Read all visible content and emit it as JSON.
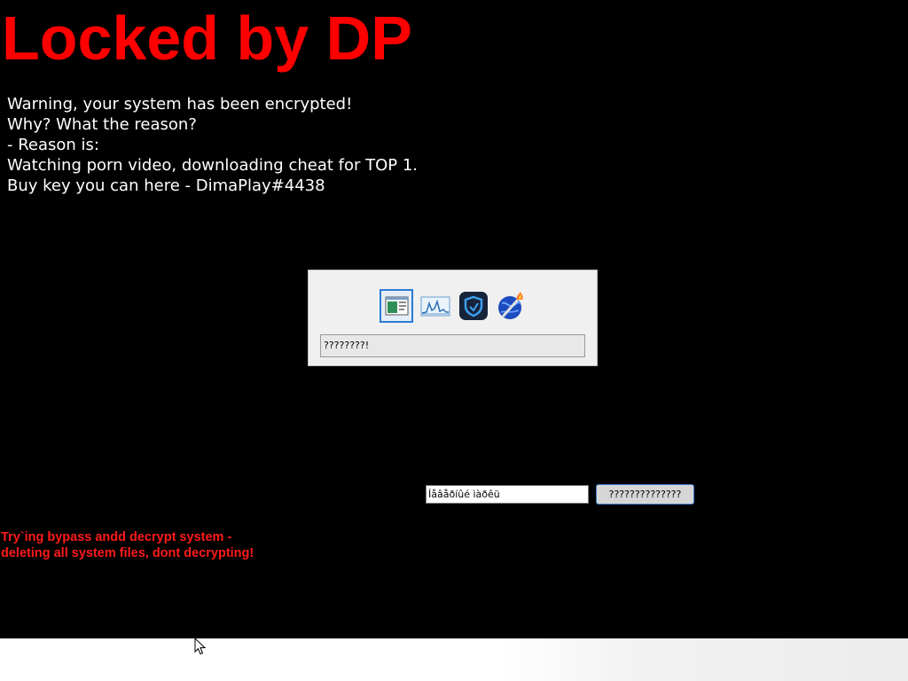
{
  "title": "Locked by DP",
  "message_lines": [
    "Warning, your system has been encrypted!",
    "Why? What the reason?",
    "- Reason is:",
    "Watching porn video, downloading cheat for TOP 1.",
    "Buy key you can here - DimaPlay#4438"
  ],
  "task_switcher": {
    "icons": [
      {
        "name": "window-app-icon",
        "selected": true
      },
      {
        "name": "performance-graph-icon",
        "selected": false
      },
      {
        "name": "shield-app-icon",
        "selected": false
      },
      {
        "name": "globe-torch-icon",
        "selected": false
      }
    ],
    "caption": "????????!"
  },
  "key_input": {
    "value": "Íåâåðíûé ìàðêü"
  },
  "unlock_button_label": "??????????????",
  "warning_lines": [
    "Try`ing bypass andd decrypt system -",
    "deleting all system files, dont decrypting!"
  ],
  "colors": {
    "title": "#ff0000",
    "message": "#ffffff",
    "warning": "#ff1a1a",
    "background": "#000000"
  }
}
